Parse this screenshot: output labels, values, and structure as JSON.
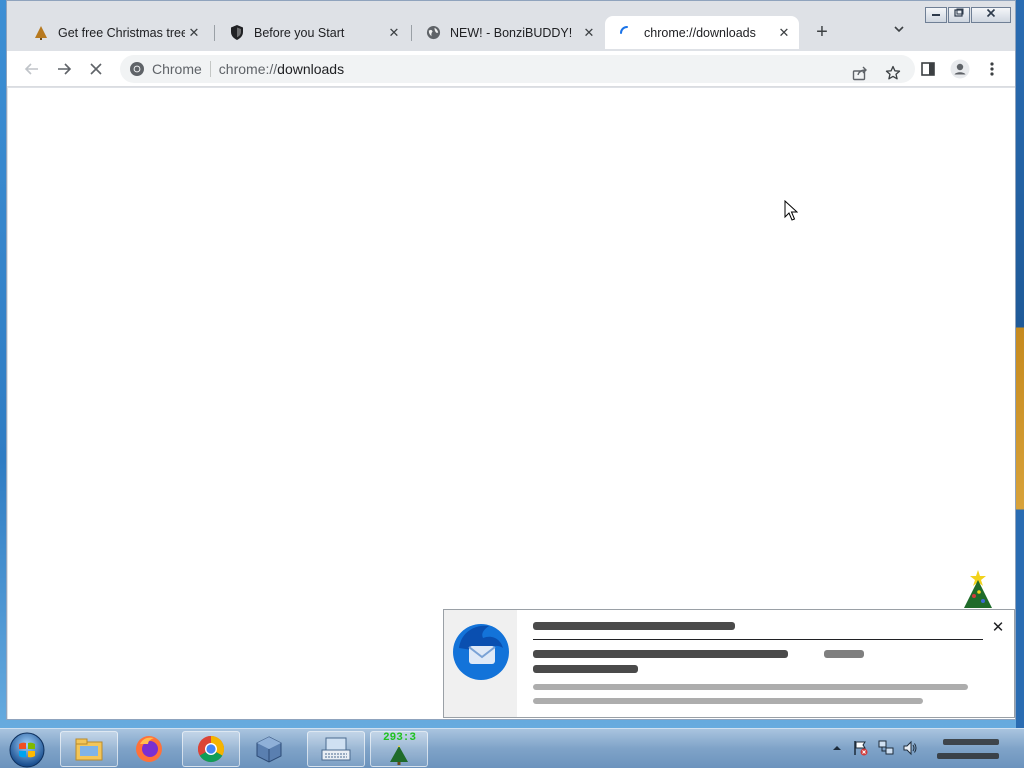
{
  "window": {
    "controls": {
      "minimize": "▭",
      "restore": "❐",
      "close": "✕"
    }
  },
  "tabs": [
    {
      "title": "Get free Christmas tree f",
      "icon": "christmas-tree-icon",
      "close": "✕"
    },
    {
      "title": "Before you Start",
      "icon": "shield-icon",
      "close": "✕"
    },
    {
      "title": "NEW! - BonziBUDDY!",
      "icon": "globe-icon",
      "close": "✕"
    },
    {
      "title": "chrome://downloads",
      "icon": "loading-spinner-icon",
      "close": "✕",
      "active": true
    }
  ],
  "tabstrip": {
    "new_tab": "+",
    "tab_search": "⌄"
  },
  "toolbar": {
    "back": "←",
    "forward": "→",
    "stop": "✕",
    "omnibox": {
      "origin_label": "Chrome",
      "url_scheme": "chrome://",
      "url_host": "downloads"
    },
    "actions": [
      "share-icon",
      "star-icon",
      "side-panel-icon",
      "profile-icon",
      "menu-icon"
    ]
  },
  "notification": {
    "app_icon": "thunderbird-icon",
    "close": "✕"
  },
  "taskbar": {
    "apps": [
      "windows-start-orb",
      "file-explorer-icon",
      "firefox-icon",
      "chrome-icon",
      "virtualbox-icon",
      "on-screen-keyboard-icon",
      "christmas-timer-app"
    ],
    "timer_app_label": "293:3",
    "tray": [
      "show-hidden-icons",
      "action-center-icon",
      "network-icon",
      "volume-icon",
      "clock"
    ]
  },
  "colors": {
    "tabstrip_bg": "#dee1e6",
    "active_tab_bg": "#ffffff",
    "omnibox_bg": "#f1f3f4",
    "taskbar": "#7fa3c8",
    "timer_text": "#1fc21f"
  }
}
